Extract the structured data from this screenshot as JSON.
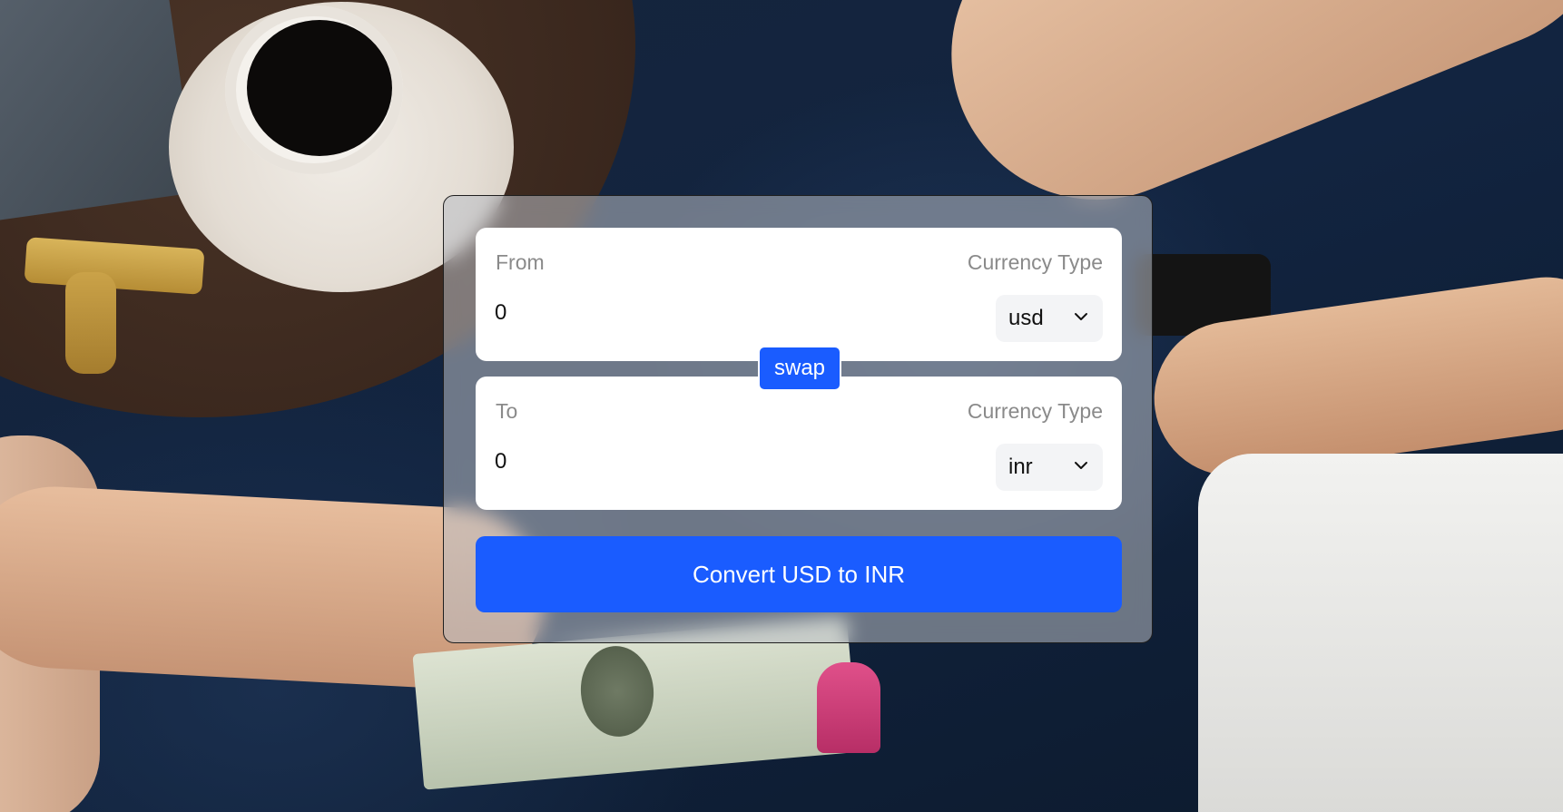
{
  "background": {
    "image": "photo of hands exchanging US dollar bills over a coffee table"
  },
  "converter": {
    "from": {
      "label": "From",
      "type_label": "Currency Type",
      "amount": "0",
      "currency": "usd"
    },
    "swap_label": "swap",
    "to": {
      "label": "To",
      "type_label": "Currency Type",
      "amount": "0",
      "currency": "inr"
    },
    "convert_label": "Convert USD to INR"
  },
  "colors": {
    "accent": "#1a5cff",
    "field_background": "#ffffff",
    "select_background": "#f3f4f6",
    "label_text": "#8a8a8a"
  },
  "icons": {
    "select_arrow": "chevron-down-icon"
  }
}
